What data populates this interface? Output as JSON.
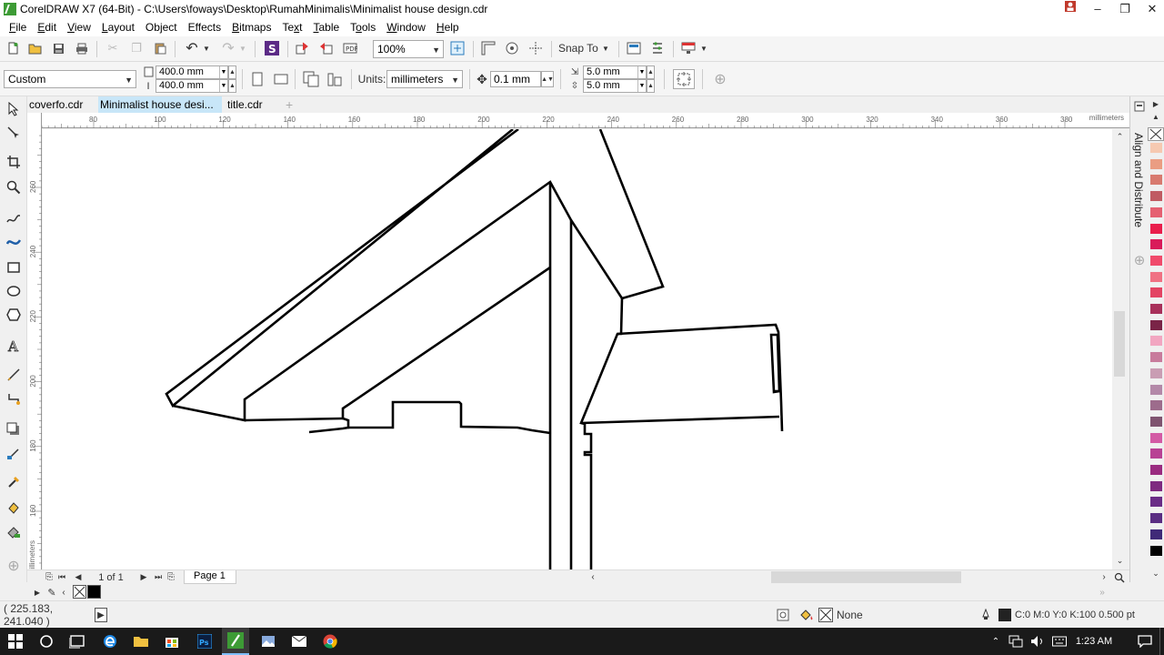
{
  "window": {
    "title": "CorelDRAW X7 (64-Bit) - C:\\Users\\foways\\Desktop\\RumahMinimalis\\Minimalist house design.cdr",
    "minimize": "–",
    "maximize": "❐",
    "close": "✕"
  },
  "menu": [
    {
      "label": "File",
      "key": "F"
    },
    {
      "label": "Edit",
      "key": "E"
    },
    {
      "label": "View",
      "key": "V"
    },
    {
      "label": "Layout",
      "key": "L"
    },
    {
      "label": "Object",
      "key": "j"
    },
    {
      "label": "Effects",
      "key": "C"
    },
    {
      "label": "Bitmaps",
      "key": "B"
    },
    {
      "label": "Text",
      "key": "x"
    },
    {
      "label": "Table",
      "key": "T"
    },
    {
      "label": "Tools",
      "key": "o"
    },
    {
      "label": "Window",
      "key": "W"
    },
    {
      "label": "Help",
      "key": "H"
    }
  ],
  "standard_toolbar": {
    "zoom_level": "100%",
    "snap_to_label": "Snap To"
  },
  "property_bar": {
    "page_size_preset": "Custom",
    "page_width": "400.0 mm",
    "page_height": "400.0 mm",
    "units_label": "Units:",
    "units_value": "millimeters",
    "nudge_distance": "0.1 mm",
    "duplicate_x": "5.0 mm",
    "duplicate_y": "5.0 mm"
  },
  "document_tabs": [
    {
      "label": "coverfo.cdr",
      "active": false
    },
    {
      "label": "Minimalist house desi...",
      "active": true
    },
    {
      "label": "title.cdr",
      "active": false
    }
  ],
  "horizontal_ruler": {
    "ticks": [
      "80",
      "100",
      "120",
      "140",
      "160",
      "180",
      "200",
      "220",
      "240",
      "260",
      "280",
      "300",
      "320",
      "340",
      "360",
      "380"
    ],
    "unit": "millimeters"
  },
  "vertical_ruler": {
    "ticks": [
      "260",
      "240",
      "220",
      "200",
      "180",
      "160"
    ],
    "unit": "millimeters"
  },
  "page_nav": {
    "page_counter": "1 of 1",
    "page_tab": "Page 1"
  },
  "docker": {
    "title": "Align and Distribute"
  },
  "color_palette": [
    "#f6c9b1",
    "#ea9d82",
    "#d87a6f",
    "#c05b62",
    "#e56071",
    "#e91e4c",
    "#d91b5a",
    "#f04a6b",
    "#f07183",
    "#e34463",
    "#a8305a",
    "#7a2447",
    "#f2a6c1",
    "#c87b9c",
    "#c99db3",
    "#b388a8",
    "#9d6c8c",
    "#7f5470",
    "#d35aa5",
    "#b84194",
    "#9a2a80",
    "#7e2a80",
    "#6a2c86",
    "#5a2d82",
    "#402a78",
    "#000000"
  ],
  "status": {
    "coordinates": "( 225.183, 241.040 )",
    "fill_label": "None",
    "outline_info": "C:0 M:0 Y:0 K:100  0.500 pt"
  },
  "taskbar": {
    "time": "1:23 AM"
  }
}
